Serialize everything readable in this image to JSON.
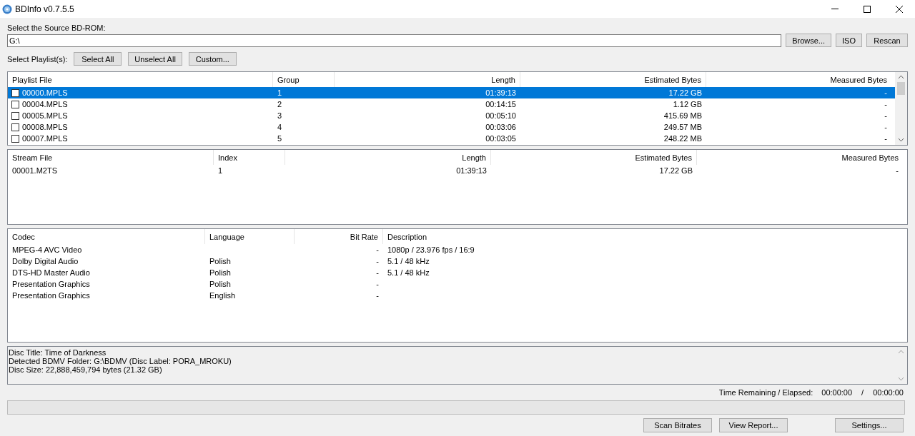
{
  "window": {
    "title": "BDInfo v0.7.5.5"
  },
  "source": {
    "label": "Select the Source BD-ROM:",
    "value": "G:\\",
    "buttons": [
      "Browse...",
      "ISO",
      "Rescan"
    ]
  },
  "playlist_select": {
    "label": "Select Playlist(s):",
    "buttons": [
      "Select All",
      "Unselect All",
      "Custom..."
    ]
  },
  "playlists": {
    "columns": [
      {
        "label": "Playlist File"
      },
      {
        "label": "Group"
      },
      {
        "label": "Length"
      },
      {
        "label": "Estimated Bytes"
      },
      {
        "label": "Measured Bytes"
      }
    ],
    "rows": [
      {
        "checked": false,
        "selected": true,
        "cells": [
          "00000.MPLS",
          "1",
          "01:39:13",
          "17.22 GB",
          "-"
        ]
      },
      {
        "checked": false,
        "selected": false,
        "cells": [
          "00004.MPLS",
          "2",
          "00:14:15",
          "1.12 GB",
          "-"
        ]
      },
      {
        "checked": false,
        "selected": false,
        "cells": [
          "00005.MPLS",
          "3",
          "00:05:10",
          "415.69 MB",
          "-"
        ]
      },
      {
        "checked": false,
        "selected": false,
        "cells": [
          "00008.MPLS",
          "4",
          "00:03:06",
          "249.57 MB",
          "-"
        ]
      },
      {
        "checked": false,
        "selected": false,
        "cells": [
          "00007.MPLS",
          "5",
          "00:03:05",
          "248.22 MB",
          "-"
        ]
      }
    ]
  },
  "streams": {
    "columns": [
      {
        "label": "Stream File"
      },
      {
        "label": "Index"
      },
      {
        "label": "Length"
      },
      {
        "label": "Estimated Bytes"
      },
      {
        "label": "Measured Bytes"
      }
    ],
    "rows": [
      {
        "cells": [
          "00001.M2TS",
          "1",
          "01:39:13",
          "17.22 GB",
          "-"
        ]
      }
    ]
  },
  "codecs": {
    "columns": [
      {
        "label": "Codec"
      },
      {
        "label": "Language"
      },
      {
        "label": "Bit Rate"
      },
      {
        "label": "Description"
      }
    ],
    "rows": [
      {
        "cells": [
          "MPEG-4 AVC Video",
          "",
          "-",
          "1080p / 23.976 fps / 16:9"
        ]
      },
      {
        "cells": [
          "Dolby Digital Audio",
          "Polish",
          "-",
          "5.1 / 48 kHz"
        ]
      },
      {
        "cells": [
          "DTS-HD Master Audio",
          "Polish",
          "-",
          "5.1 / 48 kHz"
        ]
      },
      {
        "cells": [
          "Presentation Graphics",
          "Polish",
          "-",
          ""
        ]
      },
      {
        "cells": [
          "Presentation Graphics",
          "English",
          "-",
          ""
        ]
      }
    ]
  },
  "disc_info": [
    "Disc Title: Time of Darkness",
    "Detected BDMV Folder: G:\\BDMV (Disc Label: PORA_MROKU)",
    "Disc Size: 22,888,459,794 bytes (21.32 GB)"
  ],
  "time": {
    "label": "Time Remaining / Elapsed:",
    "remaining": "00:00:00",
    "separator": "/",
    "elapsed": "00:00:00"
  },
  "progress": {
    "level": 0
  },
  "bottom_buttons": [
    "Scan Bitrates",
    "View Report...",
    "Settings..."
  ]
}
